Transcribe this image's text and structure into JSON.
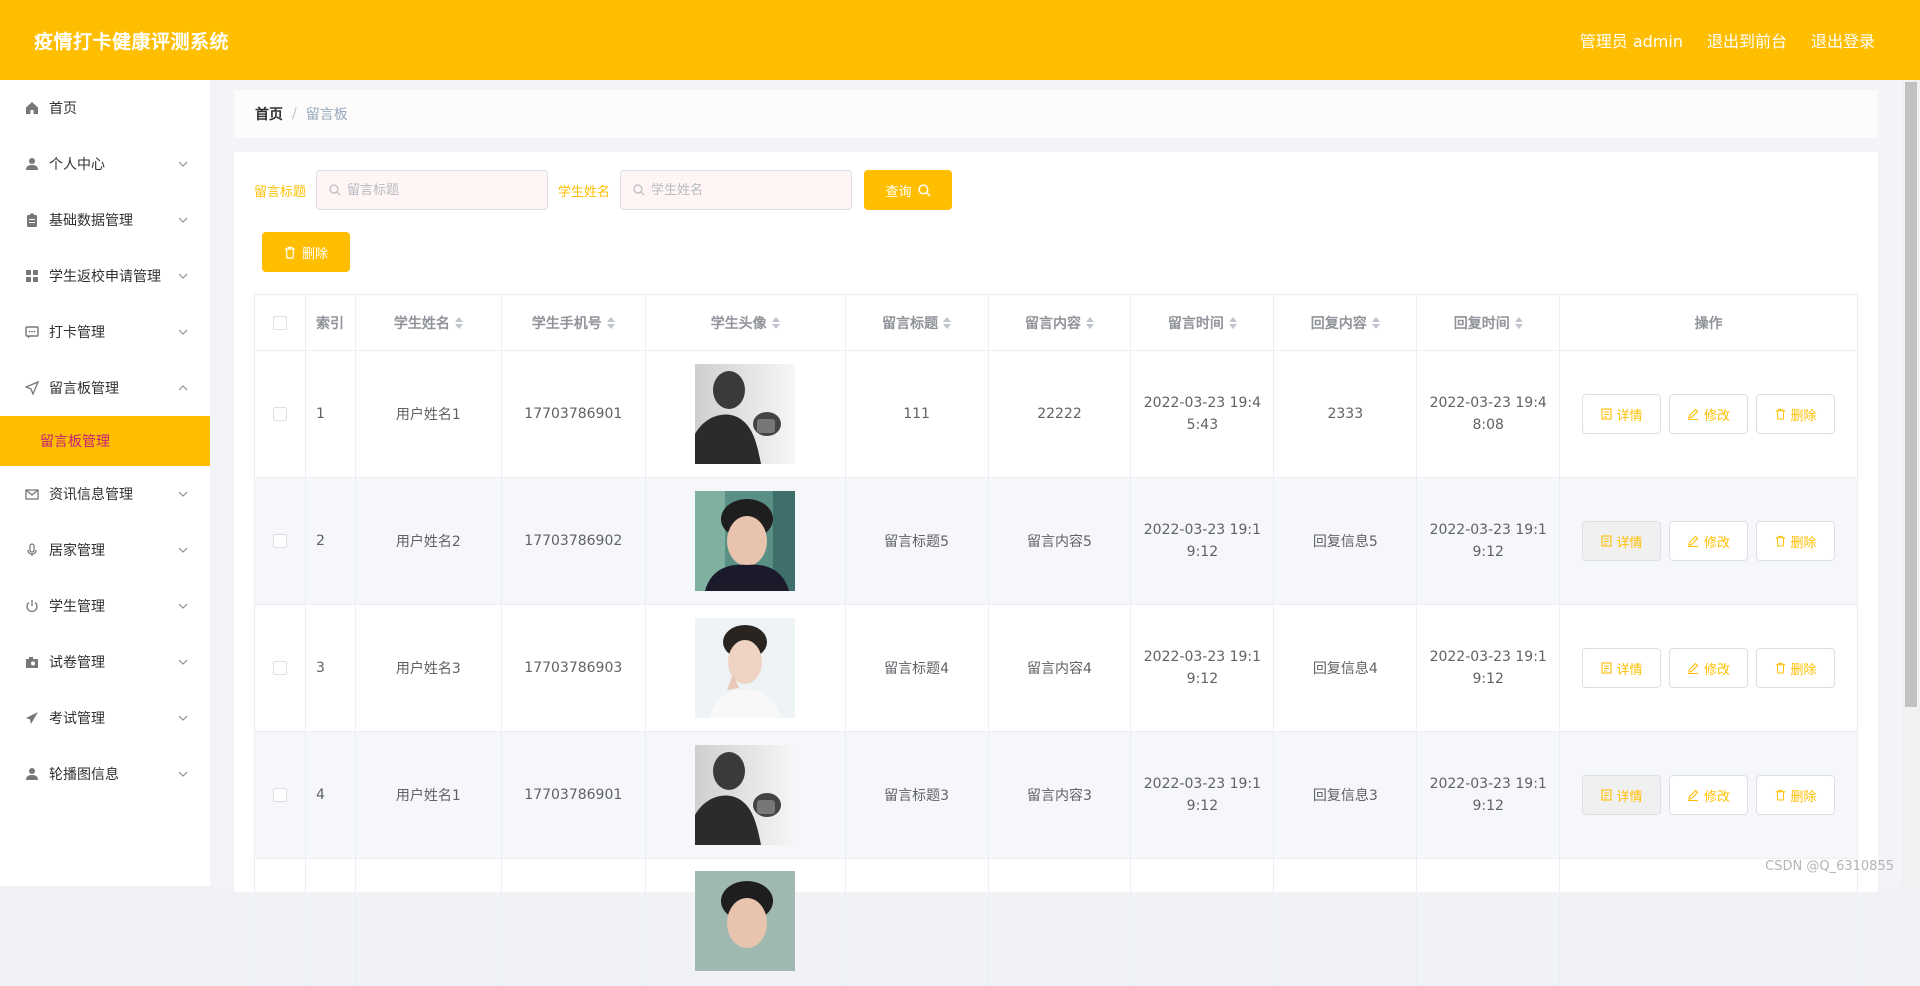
{
  "header": {
    "app_title": "疫情打卡健康评测系统",
    "admin_label": "管理员 admin",
    "frontend_link": "退出到前台",
    "logout_link": "退出登录"
  },
  "sidebar": {
    "items": [
      {
        "label": "首页",
        "icon": "home-icon"
      },
      {
        "label": "个人中心",
        "icon": "user-icon"
      },
      {
        "label": "基础数据管理",
        "icon": "clipboard-icon"
      },
      {
        "label": "学生返校申请管理",
        "icon": "grid-icon"
      },
      {
        "label": "打卡管理",
        "icon": "chat-icon"
      },
      {
        "label": "留言板管理",
        "icon": "send-icon"
      },
      {
        "label": "资讯信息管理",
        "icon": "mail-icon"
      },
      {
        "label": "居家管理",
        "icon": "mic-icon"
      },
      {
        "label": "学生管理",
        "icon": "power-icon"
      },
      {
        "label": "试卷管理",
        "icon": "camera-icon"
      },
      {
        "label": "考试管理",
        "icon": "paper-plane-icon"
      },
      {
        "label": "轮播图信息",
        "icon": "user-icon"
      }
    ],
    "active_sub": "留言板管理"
  },
  "breadcrumb": {
    "home": "首页",
    "separator": "/",
    "current": "留言板"
  },
  "search": {
    "title_label": "留言标题",
    "title_placeholder": "留言标题",
    "name_label": "学生姓名",
    "name_placeholder": "学生姓名",
    "query_button": "查询",
    "delete_button": "删除"
  },
  "table": {
    "headers": [
      "索引",
      "学生姓名",
      "学生手机号",
      "学生头像",
      "留言标题",
      "留言内容",
      "留言时间",
      "回复内容",
      "回复时间",
      "操作"
    ],
    "rows": [
      {
        "index": "1",
        "name": "用户姓名1",
        "phone": "17703786901",
        "title": "111",
        "content": "22222",
        "time": "2022-03-23 19:45:43",
        "reply": "2333",
        "reply_time": "2022-03-23 19:48:08"
      },
      {
        "index": "2",
        "name": "用户姓名2",
        "phone": "17703786902",
        "title": "留言标题5",
        "content": "留言内容5",
        "time": "2022-03-23 19:19:12",
        "reply": "回复信息5",
        "reply_time": "2022-03-23 19:19:12"
      },
      {
        "index": "3",
        "name": "用户姓名3",
        "phone": "17703786903",
        "title": "留言标题4",
        "content": "留言内容4",
        "time": "2022-03-23 19:19:12",
        "reply": "回复信息4",
        "reply_time": "2022-03-23 19:19:12"
      },
      {
        "index": "4",
        "name": "用户姓名1",
        "phone": "17703786901",
        "title": "留言标题3",
        "content": "留言内容3",
        "time": "2022-03-23 19:19:12",
        "reply": "回复信息3",
        "reply_time": "2022-03-23 19:19:12"
      }
    ],
    "ops": {
      "detail": "详情",
      "edit": "修改",
      "delete": "删除"
    }
  },
  "watermark": "CSDN @Q_6310855",
  "colors": {
    "accent": "#ffbf00",
    "active_sub_text": "#c51f79"
  }
}
